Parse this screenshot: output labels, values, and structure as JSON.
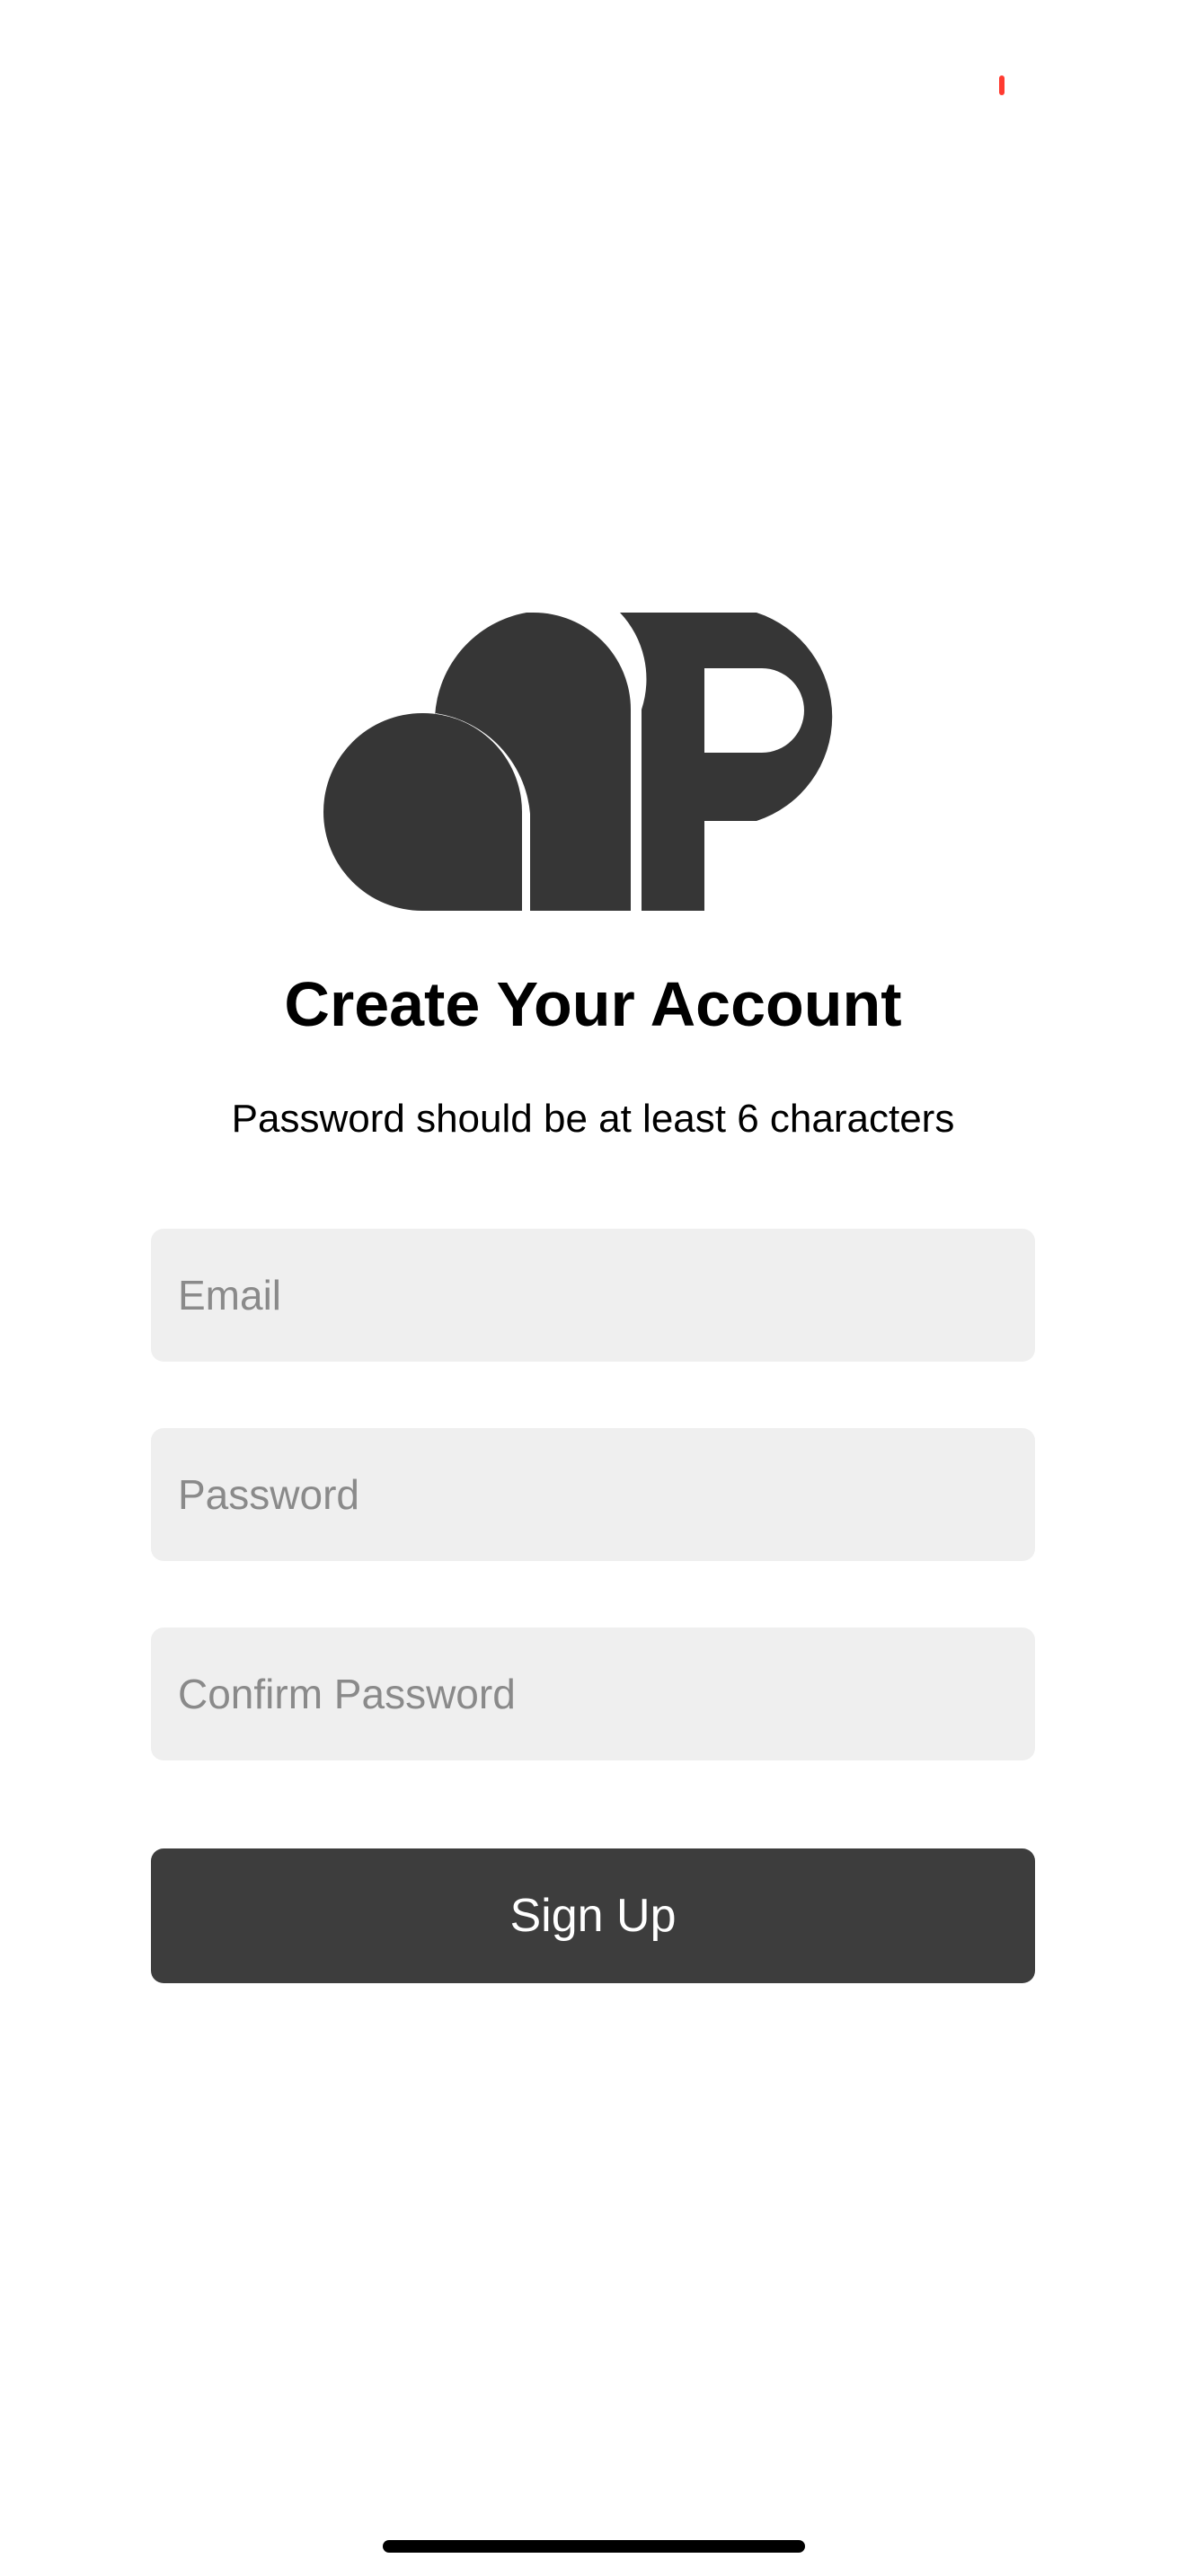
{
  "colors": {
    "background": "#ffffff",
    "logo": "#363636",
    "field_background": "#efefef",
    "placeholder": "#8a8a8a",
    "button_background": "#3d3d3d",
    "button_text": "#ffffff",
    "recording_indicator": "#ff3b30"
  },
  "logo": {
    "icon": "app-logo-icon"
  },
  "header": {
    "title": "Create Your Account",
    "subtitle": "Password should be at least 6 characters"
  },
  "form": {
    "email": {
      "value": "",
      "placeholder": "Email"
    },
    "password": {
      "value": "",
      "placeholder": "Password"
    },
    "confirm_password": {
      "value": "",
      "placeholder": "Confirm Password"
    },
    "submit_label": "Sign Up"
  }
}
